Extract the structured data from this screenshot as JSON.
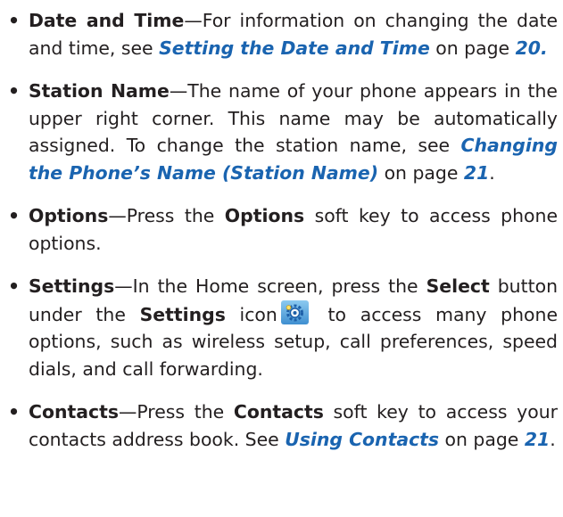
{
  "bullets": [
    {
      "term": "Date and Time",
      "text1": "—For information on changing the date and time, see ",
      "link": "Setting the Date and Time",
      "text2": " on page ",
      "page": "20."
    },
    {
      "term": "Station Name",
      "text1": "—The name of your phone appears in the upper right corner. This name may be automatically assigned. To change the station name, see ",
      "link": "Changing the Phone’s Name (Station Name)",
      "text2": "  on page ",
      "page": "21",
      "text3": "."
    },
    {
      "term": "Options",
      "text1": "—Press the ",
      "bold1": "Options",
      "text2": " soft key to access phone options."
    },
    {
      "term": "Settings",
      "text1": "—In the Home screen, press the ",
      "bold1": "Select",
      "text2": " button under the ",
      "bold2": "Settings",
      "text3": " icon",
      "icon": "settings-gear-icon",
      "text4": " to access many phone options, such as wireless setup, call preferences, speed dials, and call forwarding."
    },
    {
      "term": "Contacts",
      "text1": "—Press the ",
      "bold1": "Contacts",
      "text2": " soft key to access your contacts address book. See ",
      "link": "Using Contacts",
      "text3": " on page ",
      "page": "21",
      "text4": "."
    }
  ],
  "colors": {
    "text": "#231f20",
    "link": "#1a64b0",
    "icon_bg": "#5aa9e0"
  }
}
